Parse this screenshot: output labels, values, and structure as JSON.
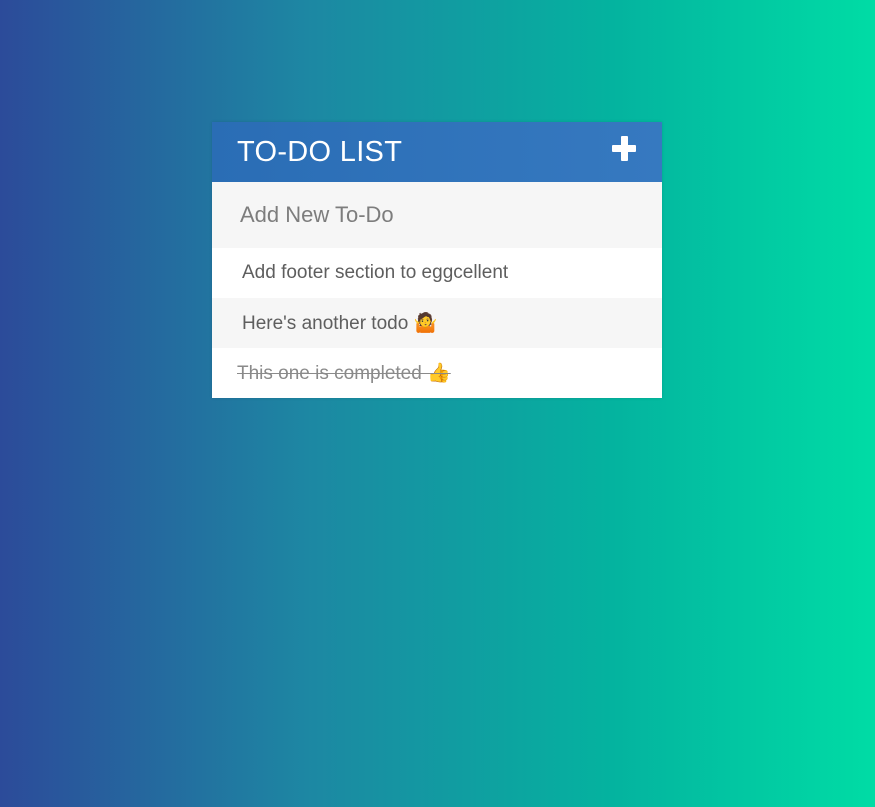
{
  "todo_app": {
    "title": "TO-DO LIST",
    "add_icon": "plus-icon",
    "input": {
      "placeholder": "Add New To-Do",
      "value": ""
    },
    "items": [
      {
        "text": "Add footer section to eggcellent",
        "completed": false
      },
      {
        "text": "Here's another todo 🤷",
        "completed": false
      },
      {
        "text": "This one is completed 👍",
        "completed": true
      }
    ]
  },
  "colors": {
    "background_gradient": [
      "#2c4b9a",
      "#1d87a3",
      "#04b39f",
      "#00dca5"
    ],
    "header": "#2f73bb",
    "input_background": "#f6f6f6",
    "text": "#5e5e5e"
  }
}
